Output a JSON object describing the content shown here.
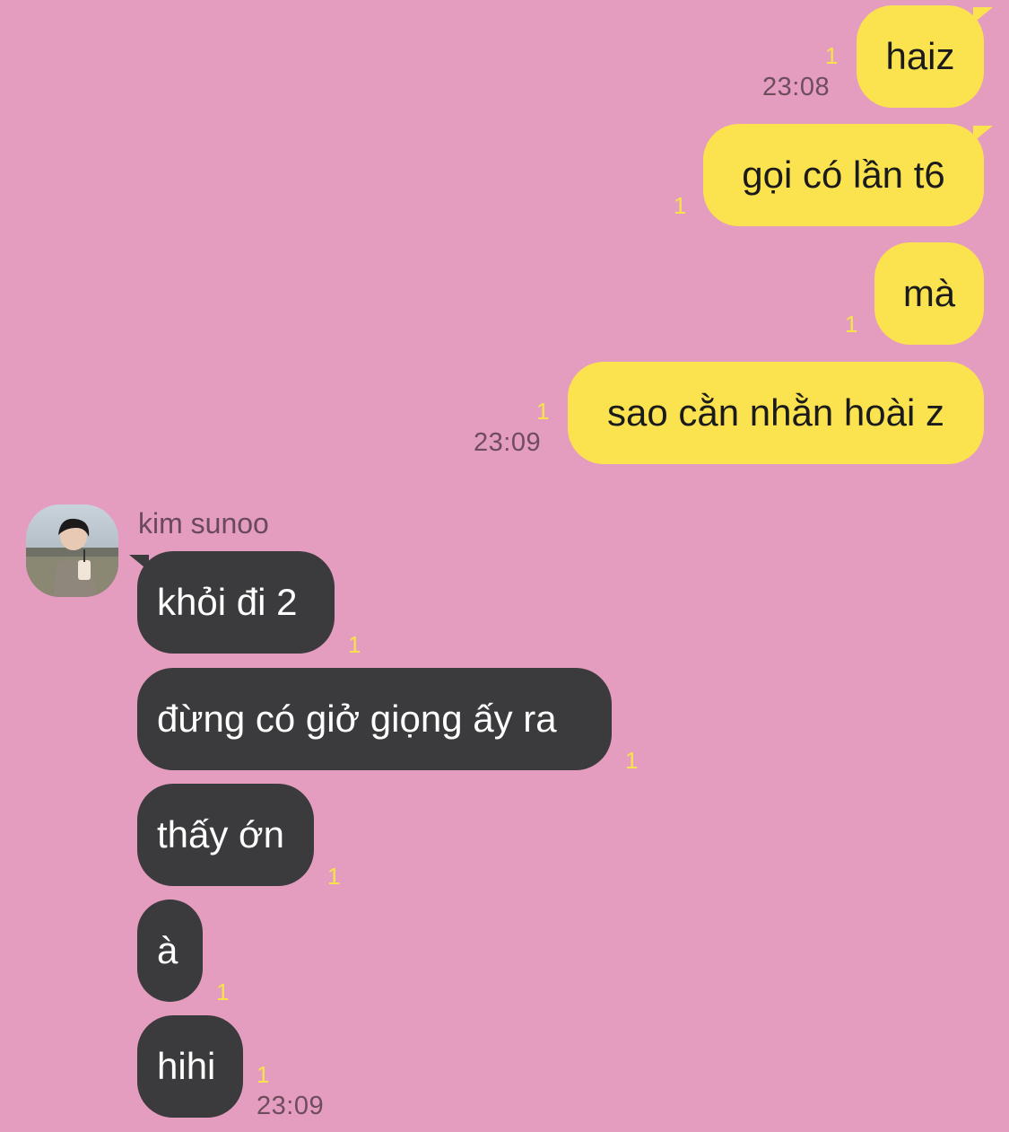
{
  "colors": {
    "background": "#e49dbe",
    "outgoing_bubble": "#fbe34f",
    "incoming_bubble": "#3b3b3d",
    "unread_count": "#f6e24a",
    "timestamp": "#6e4d5d"
  },
  "outgoing": [
    {
      "text": "haiz",
      "unread": "1",
      "time": "23:08"
    },
    {
      "text": "gọi có lần t6",
      "unread": "1"
    },
    {
      "text": "mà",
      "unread": "1"
    },
    {
      "text": "sao cằn nhằn hoài z",
      "unread": "1",
      "time": "23:09"
    }
  ],
  "incoming": {
    "sender": "kim sunoo",
    "avatar_icon": "profile-photo",
    "messages": [
      {
        "text": "khỏi đi 2",
        "unread": "1"
      },
      {
        "text": "đừng có giở giọng ấy ra",
        "unread": "1"
      },
      {
        "text": "thấy ớn",
        "unread": "1"
      },
      {
        "text": "à",
        "unread": "1"
      },
      {
        "text": "hihi",
        "unread": "1",
        "time": "23:09"
      }
    ]
  }
}
